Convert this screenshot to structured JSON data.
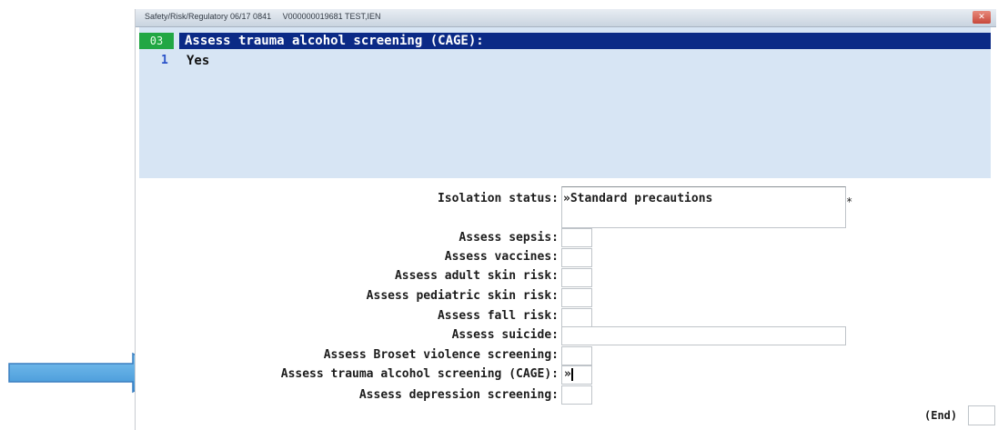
{
  "window": {
    "title_parts": [
      "Safety/Risk/Regulatory 06/17 0841",
      "V000000019681 TEST,IEN"
    ],
    "close_glyph": "✕"
  },
  "top_panel": {
    "question_number": "03",
    "question": "Assess trauma alcohol screening (CAGE):",
    "answer_number": "1",
    "answer": "Yes"
  },
  "form": {
    "rows": [
      {
        "label": "Isolation status:",
        "value": "»Standard precautions"
      },
      {
        "label": "Assess sepsis:",
        "value": ""
      },
      {
        "label": "Assess vaccines:",
        "value": ""
      },
      {
        "label": "Assess adult skin risk:",
        "value": ""
      },
      {
        "label": "Assess pediatric skin risk:",
        "value": ""
      },
      {
        "label": "Assess fall risk:",
        "value": ""
      },
      {
        "label": "Assess suicide:",
        "value": ""
      },
      {
        "label": "Assess Broset violence screening:",
        "value": ""
      },
      {
        "label": "Assess trauma alcohol screening (CAGE):",
        "value": "»"
      },
      {
        "label": "Assess depression screening:",
        "value": ""
      }
    ],
    "required_marker": "*",
    "end_label": "(End)"
  },
  "colors": {
    "accent_blue": "#0b2a86",
    "panel": "#d7e5f4",
    "question_num_green": "#22a744",
    "arrow_blue": "#56a9e2"
  }
}
